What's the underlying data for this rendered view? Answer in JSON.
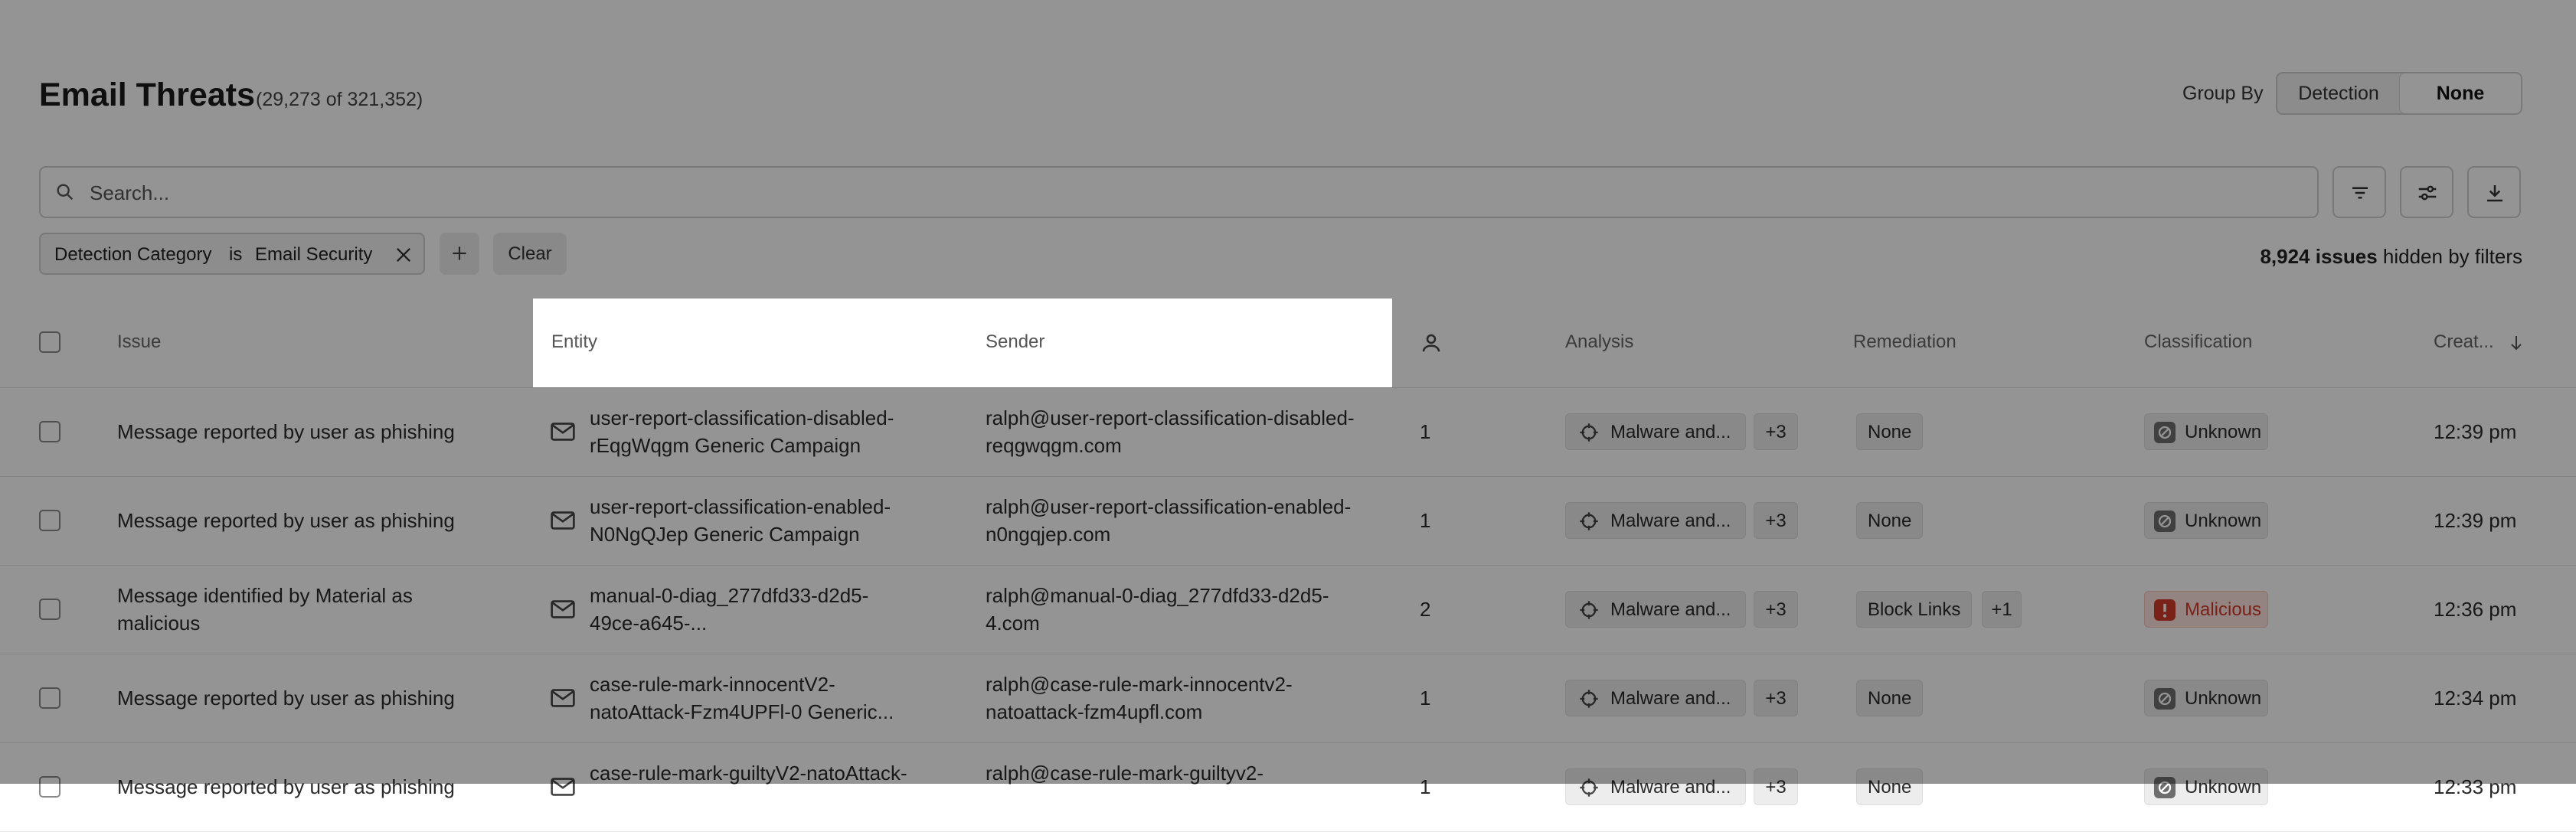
{
  "header": {
    "title": "Email Threats",
    "count": "(29,273 of 321,352)",
    "group_by_label": "Group By",
    "group_by_options": [
      "Detection",
      "None"
    ],
    "group_by_selected": "None"
  },
  "search": {
    "placeholder": "Search..."
  },
  "toolbar": {
    "icons": [
      "filter-lines-icon",
      "sliders-icon",
      "download-icon"
    ]
  },
  "filter": {
    "key": "Detection Category",
    "operator": "is",
    "value": "Email Security",
    "clear_label": "Clear"
  },
  "hidden_note": {
    "count": "8,924 issues",
    "suffix": " hidden by filters"
  },
  "table": {
    "columns": {
      "issue": "Issue",
      "entity": "Entity",
      "sender": "Sender",
      "analysis": "Analysis",
      "remediation": "Remediation",
      "classification": "Classification",
      "created": "Creat..."
    },
    "rows": [
      {
        "issue": "Message reported by user as phishing",
        "entity_line1": "user-report-classification-disabled-",
        "entity_line2": "rEqgWqgm Generic Campaign",
        "sender_line1": "ralph@user-report-classification-disabled-",
        "sender_line2": "reqgwqgm.com",
        "users": "1",
        "analysis": "Malware and...",
        "analysis_more": "+3",
        "remediation": "None",
        "remediation_more": "",
        "classification": "Unknown",
        "created": "12:39 pm"
      },
      {
        "issue": "Message reported by user as phishing",
        "entity_line1": "user-report-classification-enabled-",
        "entity_line2": "N0NgQJep Generic Campaign",
        "sender_line1": "ralph@user-report-classification-enabled-",
        "sender_line2": "n0ngqjep.com",
        "users": "1",
        "analysis": "Malware and...",
        "analysis_more": "+3",
        "remediation": "None",
        "remediation_more": "",
        "classification": "Unknown",
        "created": "12:39 pm"
      },
      {
        "issue_line1": "Message identified by Material as",
        "issue_line2": "malicious",
        "entity_line1": "manual-0-diag_277dfd33-d2d5-",
        "entity_line2": "49ce-a645-...",
        "sender_line1": "ralph@manual-0-diag_277dfd33-d2d5-",
        "sender_line2": "4.com",
        "users": "2",
        "analysis": "Malware and...",
        "analysis_more": "+3",
        "remediation": "Block Links",
        "remediation_more": "+1",
        "classification": "Malicious",
        "created": "12:36 pm"
      },
      {
        "issue": "Message reported by user as phishing",
        "entity_line1": "case-rule-mark-innocentV2-",
        "entity_line2": "natoAttack-Fzm4UPFl-0 Generic...",
        "sender_line1": "ralph@case-rule-mark-innocentv2-",
        "sender_line2": "natoattack-fzm4upfl.com",
        "users": "1",
        "analysis": "Malware and...",
        "analysis_more": "+3",
        "remediation": "None",
        "remediation_more": "",
        "classification": "Unknown",
        "created": "12:34 pm"
      },
      {
        "issue": "Message reported by user as phishing",
        "entity_line1": "case-rule-mark-guiltyV2-natoAttack-",
        "sender_line1": "ralph@case-rule-mark-guiltyv2-",
        "users": "1",
        "analysis": "Malware and...",
        "analysis_more": "+3",
        "remediation": "None",
        "classification": "Unknown",
        "created": "12:33 pm"
      }
    ]
  },
  "colors": {
    "overlay": "#000000",
    "malicious": "#d23a2a",
    "pill_bg": "#ededed"
  }
}
